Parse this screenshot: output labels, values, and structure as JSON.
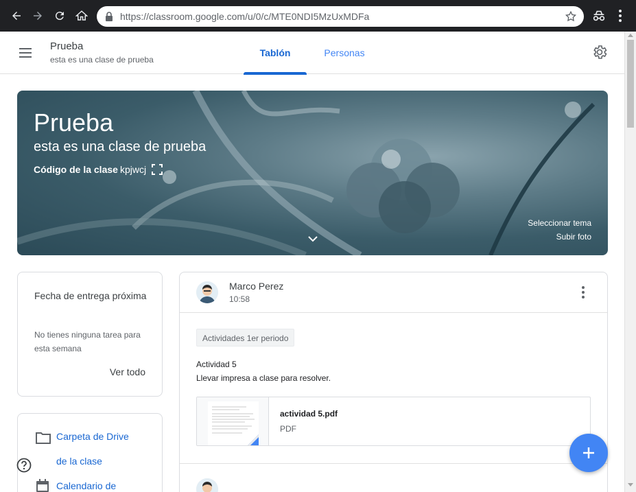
{
  "browser": {
    "url": "https://classroom.google.com/u/0/c/MTE0NDI5MzUxMDFa",
    "icons": [
      "back-icon",
      "forward-icon",
      "reload-icon",
      "home-icon",
      "lock-icon",
      "star-icon",
      "incognito-icon",
      "menu-dots-icon"
    ]
  },
  "header": {
    "class_name": "Prueba",
    "class_description": "esta es una clase de prueba",
    "tabs": [
      {
        "label": "Tablón",
        "active": true
      },
      {
        "label": "Personas",
        "active": false
      }
    ]
  },
  "banner": {
    "title": "Prueba",
    "subtitle": "esta es una clase de prueba",
    "code_label": "Código de la clase",
    "code": "kpjwcj",
    "select_theme": "Seleccionar tema",
    "upload_photo": "Subir foto"
  },
  "upcoming": {
    "title": "Fecha de entrega próxima",
    "empty_text": "No tienes ninguna tarea para esta semana",
    "view_all": "Ver todo"
  },
  "resources": {
    "items": [
      {
        "label_line1": "Carpeta de Drive",
        "label_line2": "de la clase",
        "icon": "folder-icon"
      },
      {
        "label_line1": "Calendario de",
        "icon": "calendar-icon"
      }
    ]
  },
  "post": {
    "author": "Marco Perez",
    "time": "10:58",
    "topic": "Actividades 1er periodo",
    "title": "Actividad 5",
    "description": "Llevar impresa a clase para resolver.",
    "attachment": {
      "name": "actividad 5.pdf",
      "type": "PDF"
    }
  },
  "colors": {
    "accent": "#1967d2",
    "fab": "#4285f4",
    "chrome": "#202124"
  }
}
